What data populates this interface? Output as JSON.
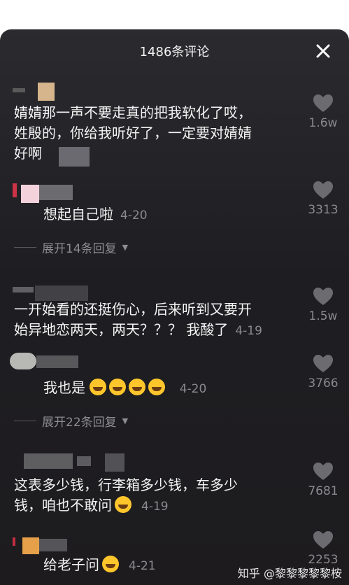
{
  "header": {
    "title": "1486条评论"
  },
  "comments": [
    {
      "text_line1": "婧婧那一声不要走真的把我软化了哎，",
      "text_line2": "姓殷的，你给我听好了，一定要对婧婧",
      "text_line3": "好啊",
      "likes": "1.6w"
    },
    {
      "text": "想起自己啦",
      "time": "4-20",
      "likes": "3313",
      "expand": "展开14条回复"
    },
    {
      "text_line1": "一开始看的还挺伤心，后来听到又要开",
      "text_line2": "始异地恋两天，两天？？？ 我酸了",
      "time": "4-19",
      "likes": "1.5w"
    },
    {
      "text": "我也是",
      "time": "4-20",
      "likes": "3766",
      "expand": "展开22条回复"
    },
    {
      "text_line1": "这表多少钱，行李箱多少钱，车多少",
      "text_line2": "钱，咱也不敢问",
      "time": "4-19",
      "likes": "7681"
    },
    {
      "text": "给老子问",
      "time": "4-21",
      "likes": "2253"
    }
  ],
  "icons": {
    "close": "close-icon",
    "heart": "heart-icon",
    "laugh": "laughing-emoji-icon",
    "grin": "grinning-emoji-icon"
  },
  "watermark": "知乎 @黎黎黎黎黎桉",
  "colors": {
    "sheet": "#1f1f23",
    "text": "#f3f3f3",
    "muted": "#8b8b8f"
  }
}
